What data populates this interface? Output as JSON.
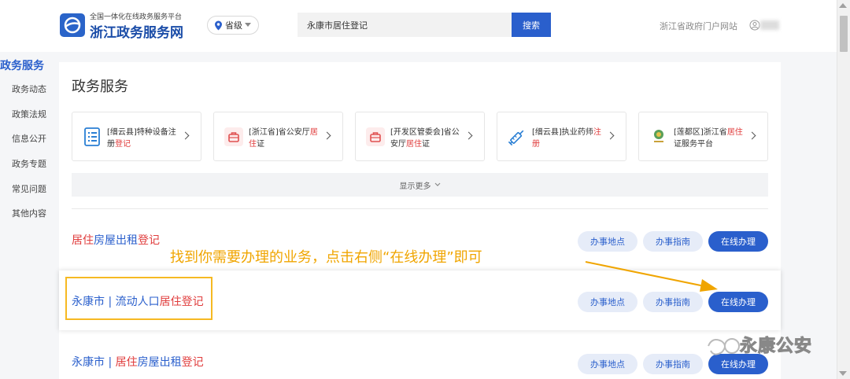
{
  "header": {
    "logo_subtitle": "全国一体化在线政务服务平台",
    "logo_title": "浙江政务服务网",
    "region": "省级",
    "search_value": "永康市居住登记",
    "search_button": "搜索",
    "portal_link": "浙江省政府门户网站"
  },
  "sidebar": {
    "title": "政务服务",
    "items": [
      "政务动态",
      "政策法规",
      "信息公开",
      "政务专题",
      "常见问题",
      "其他内容"
    ]
  },
  "main": {
    "title": "政务服务",
    "cards": [
      {
        "text_a": "[缙云县]特种设备注册",
        "text_red": "登记",
        "text_b": "",
        "icon": "list-document-icon"
      },
      {
        "text_a": "[浙江省]省公安厅",
        "text_red": "居住",
        "text_b": "证",
        "icon": "briefcase-icon"
      },
      {
        "text_a": "[开发区管委会]省公安厅",
        "text_red": "居住",
        "text_b": "证",
        "icon": "briefcase-icon"
      },
      {
        "text_a": "[缙云县]执业药师",
        "text_red": "注册",
        "text_b": "",
        "icon": "syringe-icon"
      },
      {
        "text_a": "[莲都区]浙江省",
        "text_red": "居住",
        "text_b": "证服务平台",
        "icon": "emblem-icon"
      }
    ],
    "show_more": "显示更多",
    "results": [
      {
        "prefix": "",
        "red1": "居住",
        "mid": "房屋出租",
        "red2": "登记"
      },
      {
        "prefix": "永康市 | 流动人口",
        "red1": "居住",
        "mid": "",
        "red2": "登记"
      },
      {
        "prefix": "永康市 | ",
        "red1": "居住",
        "mid": "房屋出租",
        "red2": "登记"
      }
    ],
    "btn_location": "办事地点",
    "btn_guide": "办事指南",
    "btn_online": "在线办理"
  },
  "annotation": "找到你需要办理的业务，点击右侧“在线办理”即可",
  "watermark": "永康公安",
  "colors": {
    "brand_blue": "#2a5fcc",
    "highlight_red": "#e03c3c",
    "annotation_orange": "#f0a500",
    "box_yellow": "#f6b922"
  }
}
